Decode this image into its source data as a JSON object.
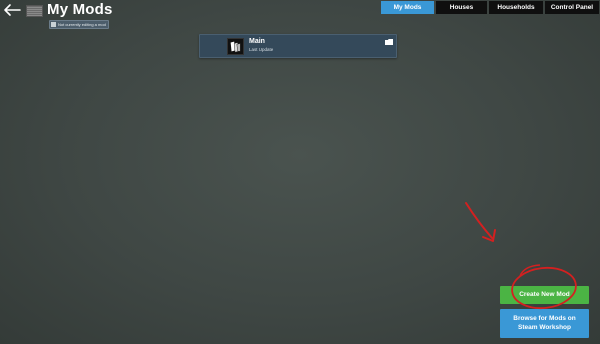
{
  "header": {
    "title": "My Mods",
    "edit_status": "Not currently editing a mod",
    "back_icon": "back-arrow-icon"
  },
  "tabs": [
    {
      "label": "My Mods",
      "active": true
    },
    {
      "label": "Houses",
      "active": false
    },
    {
      "label": "Households",
      "active": false
    },
    {
      "label": "Control Panel",
      "active": false
    }
  ],
  "mods": [
    {
      "name": "Main",
      "subtitle": "Last Update",
      "icon": "mod-icon",
      "action_icon": "folder-icon"
    }
  ],
  "actions": {
    "create_label": "Create New Mod",
    "browse_label": "Browse for Mods on Steam Workshop"
  },
  "colors": {
    "accent_blue": "#3a98d6",
    "create_green": "#4bb444",
    "card_bg": "#34495a",
    "annotation_red": "#d42020"
  }
}
